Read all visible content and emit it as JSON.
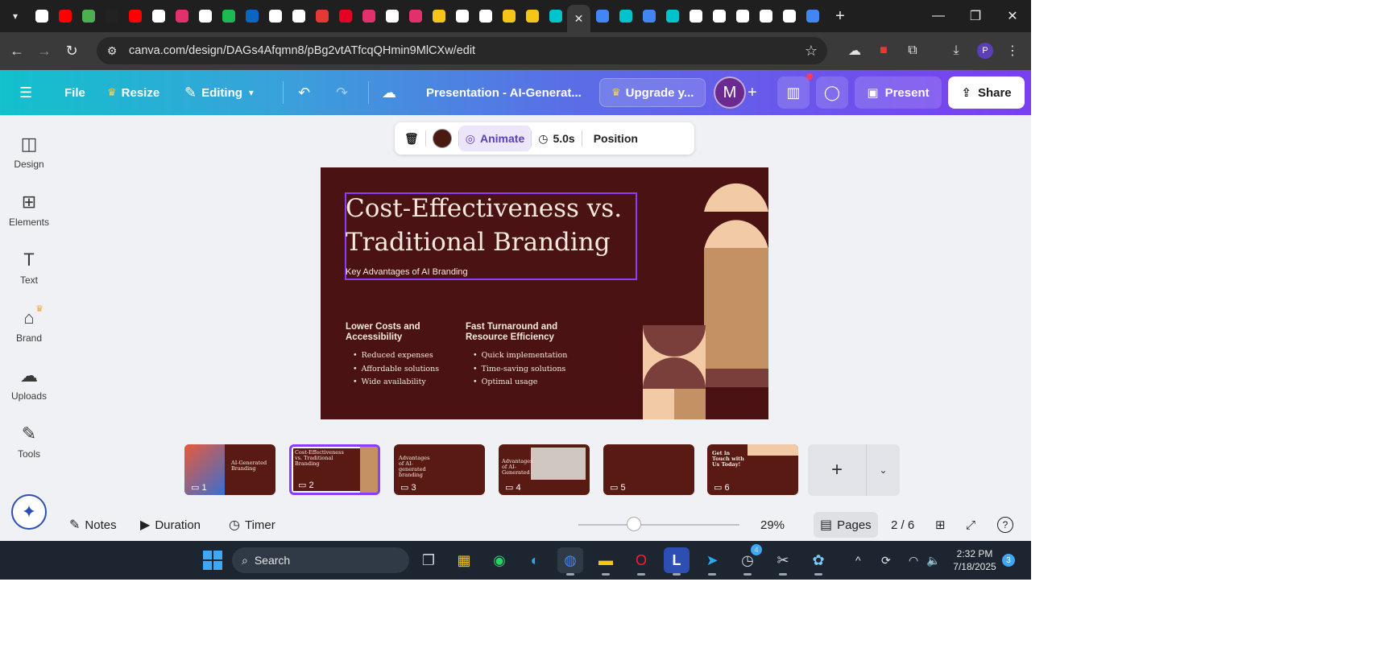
{
  "browser": {
    "url": "canva.com/design/DAGs4Afqmn8/pBg2vtATfcqQHmin9MlCXw/edit",
    "favicon_colors": [
      "#ffffff",
      "#ff0000",
      "#4caf50",
      "#222222",
      "#ff0000",
      "#ffffff",
      "#e1306c",
      "#ffffff",
      "#1db954",
      "#0a66c2",
      "#ffffff",
      "#ffffff",
      "#e53935",
      "#e60023",
      "#e1306c",
      "#ffffff",
      "#e1306c",
      "#f5c518",
      "#ffffff",
      "#ffffff",
      "#f5c518",
      "#f5c518",
      "#00c4cc",
      "#00c4cc",
      "#4285f4",
      "#00c4cc",
      "#4285f4",
      "#00c4cc",
      "#ffffff",
      "#ffffff",
      "#ffffff",
      "#ffffff",
      "#ffffff",
      "#4285f4"
    ],
    "new_tab_label": "+",
    "profile_initial": "P"
  },
  "canva_header": {
    "file_label": "File",
    "resize_label": "Resize",
    "editing_label": "Editing",
    "doc_title": "Presentation - AI-Generat...",
    "upgrade_label": "Upgrade y...",
    "avatar_initial": "M",
    "present_label": "Present",
    "share_label": "Share"
  },
  "sidebar": {
    "items": [
      {
        "label": "Design",
        "icon": "design-icon"
      },
      {
        "label": "Elements",
        "icon": "elements-icon"
      },
      {
        "label": "Text",
        "icon": "text-icon"
      },
      {
        "label": "Brand",
        "icon": "brand-icon"
      },
      {
        "label": "Uploads",
        "icon": "uploads-icon"
      },
      {
        "label": "Tools",
        "icon": "tools-icon"
      }
    ]
  },
  "floating_toolbar": {
    "color": "#4a1a12",
    "animate_label": "Animate",
    "duration_label": "5.0s",
    "position_label": "Position"
  },
  "slide": {
    "title": "Cost-Effectiveness vs. Traditional Branding",
    "subtitle": "Key Advantages of AI Branding",
    "col1_heading": "Lower Costs and Accessibility",
    "col1_items": [
      "Reduced expenses",
      "Affordable solutions",
      "Wide availability"
    ],
    "col2_heading": "Fast Turnaround and Resource Efficiency",
    "col2_items": [
      "Quick implementation",
      "Time-saving solutions",
      "Optimal usage"
    ],
    "colors": {
      "bg": "#4a1212",
      "text": "#f5e9df",
      "peach": "#f2cba6",
      "tan": "#c49165",
      "brown": "#7a3f3a"
    }
  },
  "pages": {
    "thumbs": [
      {
        "num": "1",
        "text": "AI-Generated Branding"
      },
      {
        "num": "2",
        "text": "Cost-Effectiveness vs. Traditional Branding"
      },
      {
        "num": "3",
        "text": "Advantages of AI-generated branding"
      },
      {
        "num": "4",
        "text": "Advantages of AI-Generated"
      },
      {
        "num": "5",
        "text": ""
      },
      {
        "num": "6",
        "text": "Get in Touch with Us Today!"
      }
    ]
  },
  "bottom_bar": {
    "notes_label": "Notes",
    "duration_label": "Duration",
    "timer_label": "Timer",
    "zoom_value": "29%",
    "pages_label": "Pages",
    "page_counter": "2 / 6",
    "help_label": "?"
  },
  "taskbar": {
    "search_label": "Search",
    "time": "2:32 PM",
    "date": "7/18/2025",
    "notification_count": "3",
    "clock_badge": "4"
  }
}
